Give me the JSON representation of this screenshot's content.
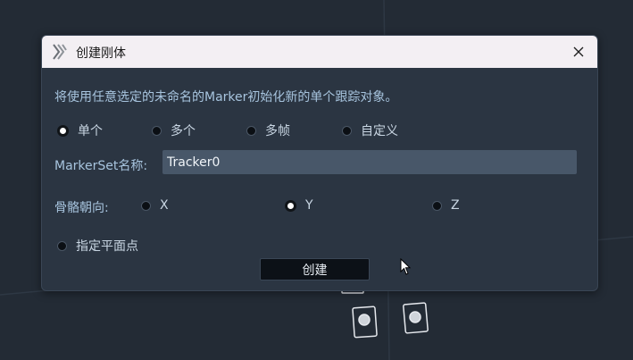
{
  "dialog": {
    "title": "创建刚体",
    "description": "将使用任意选定的未命名的Marker初始化新的单个跟踪对象。",
    "mode_options": [
      {
        "label": "单个",
        "checked": true
      },
      {
        "label": "多个",
        "checked": false
      },
      {
        "label": "多帧",
        "checked": false
      },
      {
        "label": "自定义",
        "checked": false
      }
    ],
    "markerset_label": "MarkerSet名称:",
    "markerset_value": "Tracker0",
    "axis_label": "骨骼朝向:",
    "axis_options": [
      {
        "label": "X",
        "checked": false
      },
      {
        "label": "Y",
        "checked": true
      },
      {
        "label": "Z",
        "checked": false
      }
    ],
    "plane_point_label": "指定平面点",
    "create_button": "创建"
  },
  "colors": {
    "background": "#232b35",
    "dialog_bg": "#2b3542",
    "titlebar_bg": "#f3eff3",
    "text_accent": "#a7c4de",
    "input_bg": "#485769"
  },
  "icons": {
    "app": "app-logo-icon",
    "close": "close-icon",
    "cursor": "mouse-cursor-icon"
  }
}
